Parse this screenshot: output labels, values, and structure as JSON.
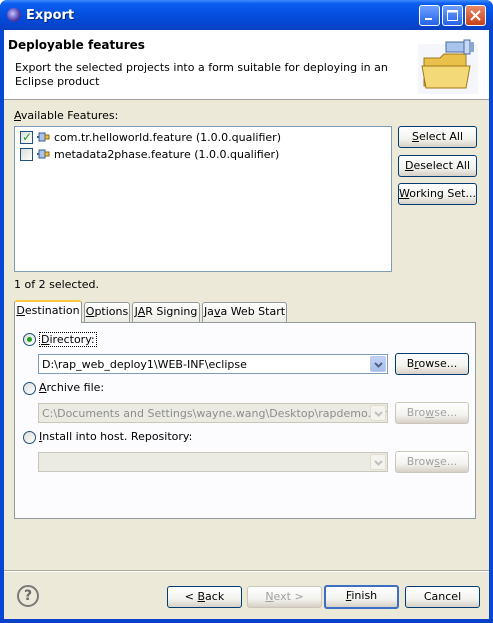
{
  "window": {
    "title": "Export"
  },
  "header": {
    "title": "Deployable features",
    "description": "Export the selected projects into a form suitable for deploying in an Eclipse product"
  },
  "features": {
    "label_prefix": "",
    "label_mnemonic": "A",
    "label_rest": "vailable Features:",
    "items": [
      {
        "label": "com.tr.helloworld.feature (1.0.0.qualifier)",
        "checked": true
      },
      {
        "label": "metadata2phase.feature (1.0.0.qualifier)",
        "checked": false
      }
    ],
    "selection_status": "1 of 2 selected."
  },
  "side_buttons": {
    "select_all": "Select All",
    "deselect_all": "Deselect All",
    "working_set": "Working Set..."
  },
  "tabs": [
    {
      "label": "Destination",
      "active": true
    },
    {
      "label": "Options",
      "active": false
    },
    {
      "label": "JAR Signing",
      "active": false
    },
    {
      "label": "Java Web Start",
      "active": false
    }
  ],
  "destination": {
    "directory_label": "Directory:",
    "directory_selected": true,
    "directory_value": "D:\\rap_web_deploy1\\WEB-INF\\eclipse",
    "archive_label": "Archive file:",
    "archive_value": "C:\\Documents and Settings\\wayne.wang\\Desktop\\rapdemo.rar",
    "install_label": "Install into host. Repository:",
    "install_value": "",
    "browse_label": "Browse..."
  },
  "footer": {
    "back": "< Back",
    "next": "Next >",
    "finish": "Finish",
    "cancel": "Cancel",
    "help_glyph": "?"
  },
  "colors": {
    "titlebar": "#0550e0",
    "dialog_bg": "#ece9d8",
    "tab_active_accent": "#ffc83c",
    "checkmark": "#21a121"
  }
}
